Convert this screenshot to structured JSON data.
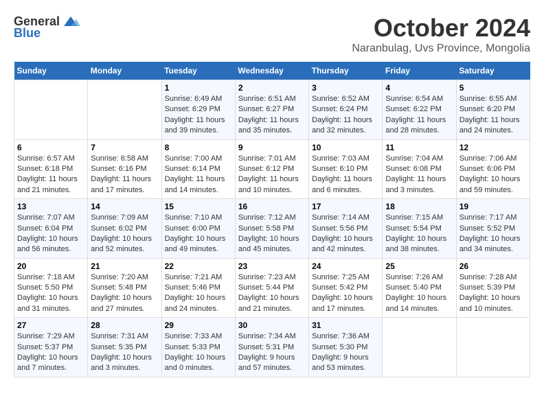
{
  "logo": {
    "general": "General",
    "blue": "Blue"
  },
  "header": {
    "month": "October 2024",
    "location": "Naranbulag, Uvs Province, Mongolia"
  },
  "weekdays": [
    "Sunday",
    "Monday",
    "Tuesday",
    "Wednesday",
    "Thursday",
    "Friday",
    "Saturday"
  ],
  "weeks": [
    [
      {
        "day": "",
        "info": ""
      },
      {
        "day": "",
        "info": ""
      },
      {
        "day": "1",
        "info": "Sunrise: 6:49 AM\nSunset: 6:29 PM\nDaylight: 11 hours and 39 minutes."
      },
      {
        "day": "2",
        "info": "Sunrise: 6:51 AM\nSunset: 6:27 PM\nDaylight: 11 hours and 35 minutes."
      },
      {
        "day": "3",
        "info": "Sunrise: 6:52 AM\nSunset: 6:24 PM\nDaylight: 11 hours and 32 minutes."
      },
      {
        "day": "4",
        "info": "Sunrise: 6:54 AM\nSunset: 6:22 PM\nDaylight: 11 hours and 28 minutes."
      },
      {
        "day": "5",
        "info": "Sunrise: 6:55 AM\nSunset: 6:20 PM\nDaylight: 11 hours and 24 minutes."
      }
    ],
    [
      {
        "day": "6",
        "info": "Sunrise: 6:57 AM\nSunset: 6:18 PM\nDaylight: 11 hours and 21 minutes."
      },
      {
        "day": "7",
        "info": "Sunrise: 6:58 AM\nSunset: 6:16 PM\nDaylight: 11 hours and 17 minutes."
      },
      {
        "day": "8",
        "info": "Sunrise: 7:00 AM\nSunset: 6:14 PM\nDaylight: 11 hours and 14 minutes."
      },
      {
        "day": "9",
        "info": "Sunrise: 7:01 AM\nSunset: 6:12 PM\nDaylight: 11 hours and 10 minutes."
      },
      {
        "day": "10",
        "info": "Sunrise: 7:03 AM\nSunset: 6:10 PM\nDaylight: 11 hours and 6 minutes."
      },
      {
        "day": "11",
        "info": "Sunrise: 7:04 AM\nSunset: 6:08 PM\nDaylight: 11 hours and 3 minutes."
      },
      {
        "day": "12",
        "info": "Sunrise: 7:06 AM\nSunset: 6:06 PM\nDaylight: 10 hours and 59 minutes."
      }
    ],
    [
      {
        "day": "13",
        "info": "Sunrise: 7:07 AM\nSunset: 6:04 PM\nDaylight: 10 hours and 56 minutes."
      },
      {
        "day": "14",
        "info": "Sunrise: 7:09 AM\nSunset: 6:02 PM\nDaylight: 10 hours and 52 minutes."
      },
      {
        "day": "15",
        "info": "Sunrise: 7:10 AM\nSunset: 6:00 PM\nDaylight: 10 hours and 49 minutes."
      },
      {
        "day": "16",
        "info": "Sunrise: 7:12 AM\nSunset: 5:58 PM\nDaylight: 10 hours and 45 minutes."
      },
      {
        "day": "17",
        "info": "Sunrise: 7:14 AM\nSunset: 5:56 PM\nDaylight: 10 hours and 42 minutes."
      },
      {
        "day": "18",
        "info": "Sunrise: 7:15 AM\nSunset: 5:54 PM\nDaylight: 10 hours and 38 minutes."
      },
      {
        "day": "19",
        "info": "Sunrise: 7:17 AM\nSunset: 5:52 PM\nDaylight: 10 hours and 34 minutes."
      }
    ],
    [
      {
        "day": "20",
        "info": "Sunrise: 7:18 AM\nSunset: 5:50 PM\nDaylight: 10 hours and 31 minutes."
      },
      {
        "day": "21",
        "info": "Sunrise: 7:20 AM\nSunset: 5:48 PM\nDaylight: 10 hours and 27 minutes."
      },
      {
        "day": "22",
        "info": "Sunrise: 7:21 AM\nSunset: 5:46 PM\nDaylight: 10 hours and 24 minutes."
      },
      {
        "day": "23",
        "info": "Sunrise: 7:23 AM\nSunset: 5:44 PM\nDaylight: 10 hours and 21 minutes."
      },
      {
        "day": "24",
        "info": "Sunrise: 7:25 AM\nSunset: 5:42 PM\nDaylight: 10 hours and 17 minutes."
      },
      {
        "day": "25",
        "info": "Sunrise: 7:26 AM\nSunset: 5:40 PM\nDaylight: 10 hours and 14 minutes."
      },
      {
        "day": "26",
        "info": "Sunrise: 7:28 AM\nSunset: 5:39 PM\nDaylight: 10 hours and 10 minutes."
      }
    ],
    [
      {
        "day": "27",
        "info": "Sunrise: 7:29 AM\nSunset: 5:37 PM\nDaylight: 10 hours and 7 minutes."
      },
      {
        "day": "28",
        "info": "Sunrise: 7:31 AM\nSunset: 5:35 PM\nDaylight: 10 hours and 3 minutes."
      },
      {
        "day": "29",
        "info": "Sunrise: 7:33 AM\nSunset: 5:33 PM\nDaylight: 10 hours and 0 minutes."
      },
      {
        "day": "30",
        "info": "Sunrise: 7:34 AM\nSunset: 5:31 PM\nDaylight: 9 hours and 57 minutes."
      },
      {
        "day": "31",
        "info": "Sunrise: 7:36 AM\nSunset: 5:30 PM\nDaylight: 9 hours and 53 minutes."
      },
      {
        "day": "",
        "info": ""
      },
      {
        "day": "",
        "info": ""
      }
    ]
  ]
}
